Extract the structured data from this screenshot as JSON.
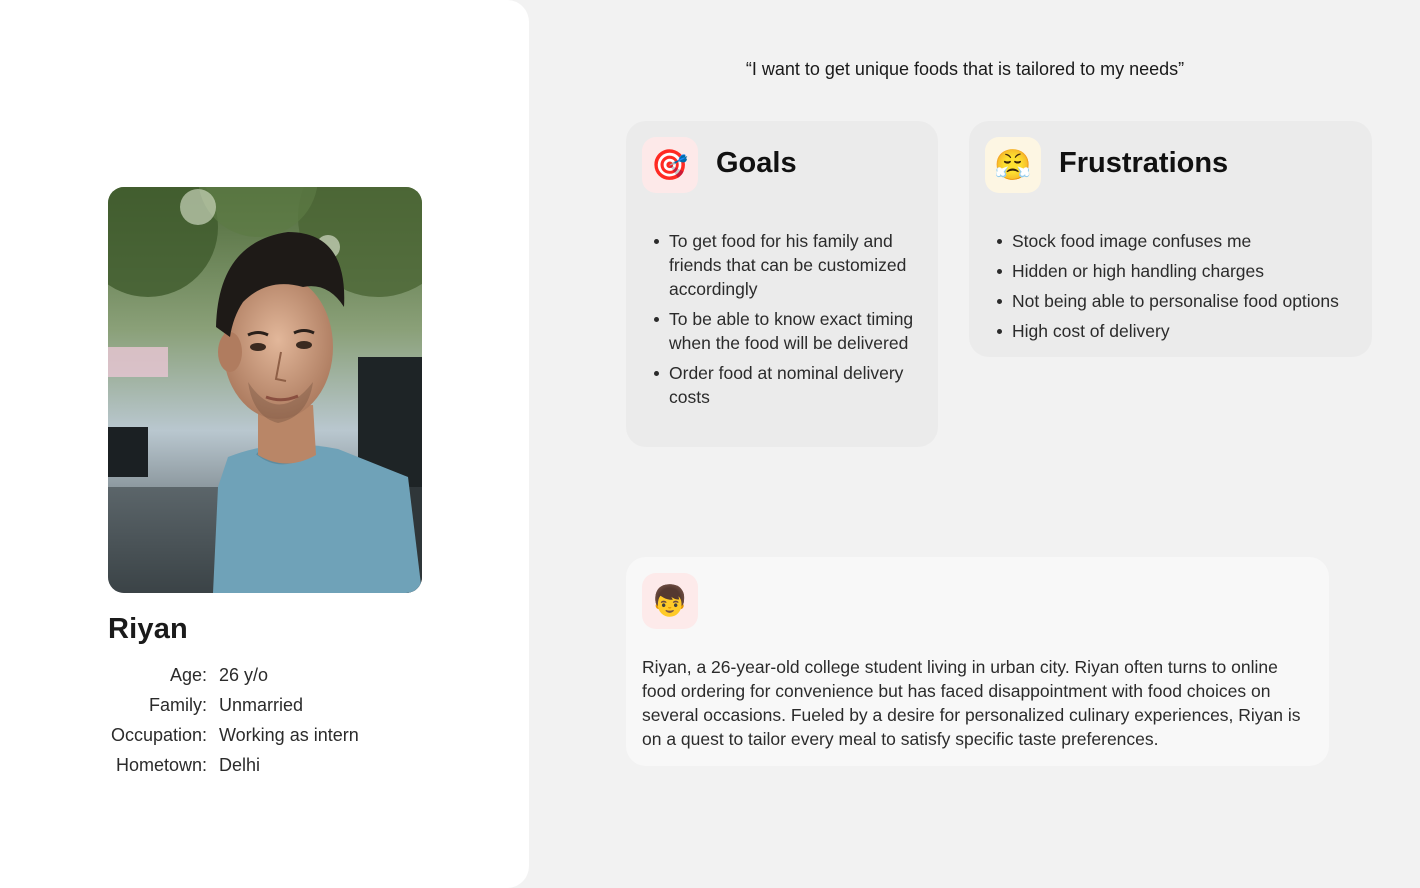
{
  "profile": {
    "name": "Riyan",
    "photo_alt": "Photo of Riyan",
    "details": [
      {
        "label": "Age:",
        "value": "26 y/o"
      },
      {
        "label": "Family:",
        "value": "Unmarried"
      },
      {
        "label": "Occupation:",
        "value": "Working as intern"
      },
      {
        "label": "Hometown:",
        "value": "Delhi"
      }
    ]
  },
  "quote": "“I want to get unique foods that is tailored to my needs”",
  "goals": {
    "icon": "target-icon",
    "emoji": "🎯",
    "title": "Goals",
    "items": [
      "To get food for his family and friends that can be customized accordingly",
      "To be able to know exact timing when the food will be delivered",
      "Order food at nominal delivery costs"
    ]
  },
  "frustrations": {
    "icon": "steaming-face-icon",
    "emoji": "😤",
    "title": "Frustrations",
    "items": [
      "Stock food image confuses me",
      "Hidden or high handling charges",
      "Not being able to personalise food options",
      "High cost of delivery"
    ]
  },
  "bio": {
    "icon": "boy-face-icon",
    "emoji": "👦",
    "text": "Riyan, a 26-year-old college student living in urban city. Riyan often turns to online food ordering for convenience but has faced disappointment with food choices on several occasions. Fueled by a desire for personalized culinary experiences, Riyan is on a quest to tailor every meal to satisfy specific taste preferences."
  }
}
